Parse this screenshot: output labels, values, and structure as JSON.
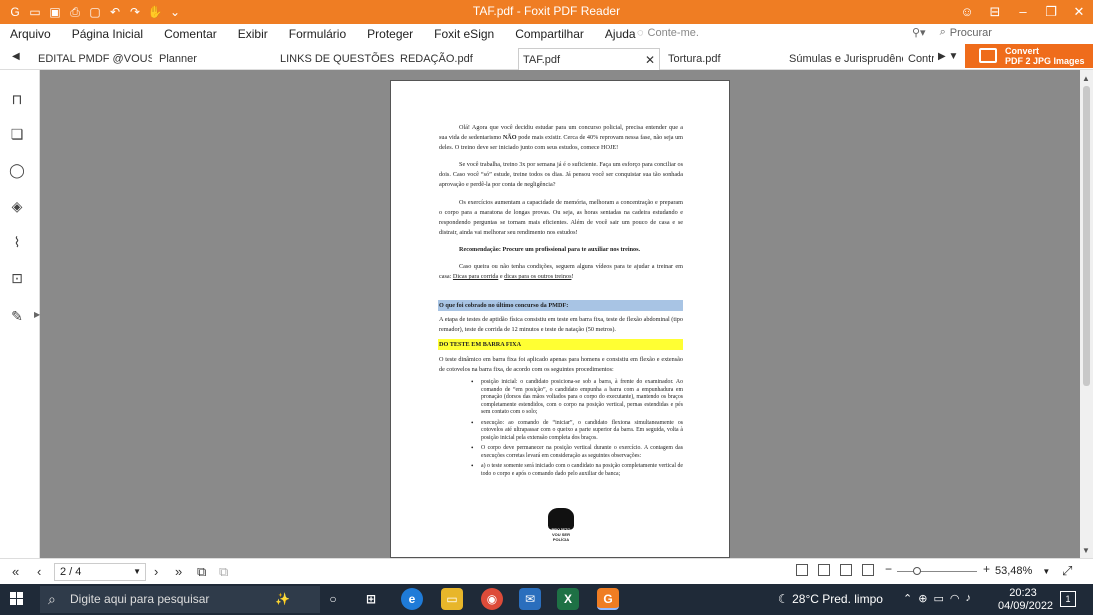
{
  "window": {
    "title": "TAF.pdf - Foxit PDF Reader"
  },
  "menu": {
    "items": [
      "Arquivo",
      "Página Inicial",
      "Comentar",
      "Exibir",
      "Formulário",
      "Proteger",
      "Foxit eSign",
      "Compartilhar",
      "Ajuda"
    ],
    "tell_me_placeholder": "Conte-me.",
    "search_placeholder": "Procurar"
  },
  "tabs": [
    {
      "label": "EDITAL PMDF @VOUS...",
      "active": false
    },
    {
      "label": "Planner",
      "active": false
    },
    {
      "label": "LINKS DE QUESTÕES ...",
      "active": false
    },
    {
      "label": "REDAÇÃO.pdf",
      "active": false
    },
    {
      "label": "TAF.pdf",
      "active": true
    },
    {
      "label": "Tortura.pdf",
      "active": false
    },
    {
      "label": "Súmulas e Jurisprudênc...",
      "active": false
    },
    {
      "label": "Contr",
      "active": false
    }
  ],
  "convert_banner": {
    "line1": "Convert",
    "line2": "PDF 2 JPG Images"
  },
  "document": {
    "paragraph1_pre": "Olá! Agora que você decidiu estudar para um concurso policial, precisa entender que a sua vida de sedentarismo ",
    "paragraph1_bold": "NÃO",
    "paragraph1_post": " pode mais existir. Cerca de 40% reprovam nessa fase, não seja um deles. O treino deve ser iniciado junto com seus estudos, comece HOJE!",
    "paragraph2": "Se você trabalha, treino 3x por semana já é o suficiente. Faça um esforço para conciliar os dois. Caso você “só” estude, treine todos os dias. Já pensou você ser conquistar sua tão sonhada aprovação e perdê-la por conta de negligência?",
    "paragraph3": "Os exercícios aumentam a capacidade de memória, melhoram a concentração e preparam o corpo para a maratona de longas provas. Ou seja, as horas sentadas na cadeira estudando e respondendo perguntas se tornam mais eficientes. Além de você sair um pouco de casa e se distrair, ainda vai melhorar seu rendimento nos estudos!",
    "recommendation": "Recomendação: Procure um profissional para te auxiliar nos treinos.",
    "paragraph4_pre": "Caso queira ou não tenha condições, seguem alguns vídeos para te ajudar a treinar em casa: ",
    "paragraph4_link1": "Dicas para corrida",
    "paragraph4_mid": " e ",
    "paragraph4_link2": "dicas para os outros treinos",
    "paragraph4_end": "!",
    "heading_blue": "O que foi cobrado no último concurso da PMDF:",
    "paragraph5": "A etapa de testes de aptidão física consistiu em teste em barra fixa, teste de flexão abdominal (tipo remador), teste de corrida de 12 minutos e teste de natação (50 metros).",
    "heading_yellow": "DO TESTE EM BARRA FIXA",
    "paragraph6": "O teste dinâmico em barra fixa foi aplicado apenas para homens e consistiu em flexão e extensão de cotovelos na barra fixa, de acordo com os seguintes procedimentos:",
    "bullets": [
      "posição inicial: o candidato posiciona-se sob a barra, à frente do examinador. Ao comando de “em posição”, o candidato empunha a barra com a empunhadura em pronação (dorsos das mãos voltados para o corpo do executante), mantendo os braços completamente estendidos, com o corpo na posição vertical, pernas estendidas e pés sem contato com o solo;",
      "execução: ao comando de “iniciar”, o candidato flexiona simultaneamente os cotovelos até ultrapassar com o queixo a parte superior da barra. Em seguida, volta à posição inicial pela extensão completa dos braços.",
      "O corpo deve permanecer na posição vertical durante o exercício. A contagem das execuções corretas levará em consideração as seguintes observações:",
      "a) o teste somente será iniciado com o candidato na posição completamente vertical de todo o corpo e após o comando dado pelo auxiliar de banca;"
    ],
    "logo_line1": "PROJETO",
    "logo_line2": "VOU SER",
    "logo_line3": "POLÍCIA"
  },
  "statusbar": {
    "page_indicator": "2 / 4",
    "zoom": "53,48%",
    "zoom_fraction": 0.25
  },
  "taskbar": {
    "search_placeholder": "Digite aqui para pesquisar",
    "weather": "28°C  Pred. limpo",
    "time": "20:23",
    "date": "04/09/2022",
    "notification_count": "1"
  }
}
